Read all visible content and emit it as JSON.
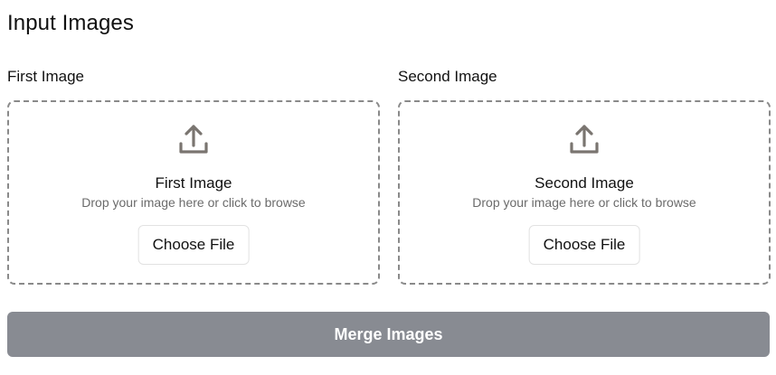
{
  "section": {
    "title": "Input Images"
  },
  "inputs": [
    {
      "label": "First Image",
      "dropzone_title": "First Image",
      "dropzone_hint": "Drop your image here or click to browse",
      "button_label": "Choose File",
      "icon": "upload-icon"
    },
    {
      "label": "Second Image",
      "dropzone_title": "Second Image",
      "dropzone_hint": "Drop your image here or click to browse",
      "button_label": "Choose File",
      "icon": "upload-icon"
    }
  ],
  "actions": {
    "merge_label": "Merge Images",
    "merge_enabled": false
  },
  "colors": {
    "icon": "#7a7570",
    "dropzone_border": "#8a8a8a",
    "hint_text": "#6b6b6b",
    "merge_button_bg": "#888b92"
  }
}
